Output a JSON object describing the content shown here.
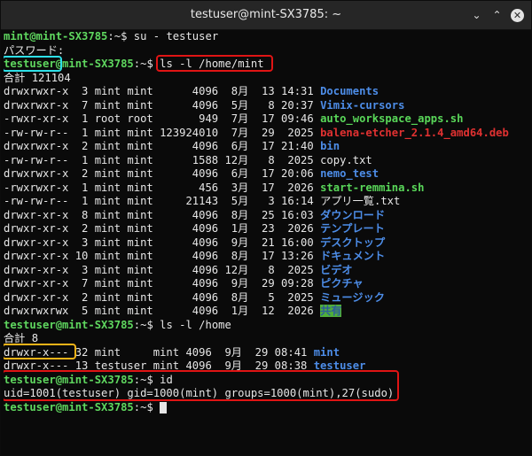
{
  "window": {
    "title": "testuser@mint-SX3785: ~"
  },
  "prompt_symbol": "$",
  "lines": {
    "l1": {
      "prompt": "mint@mint-SX3785",
      "path": ":~",
      "cmd": " su - testuser"
    },
    "l2": {
      "text": "パスワード:"
    },
    "l3": {
      "user": "testuser",
      "host": "@mint-SX3785",
      "path": ":~",
      "cmd": "ls -l /home/mint"
    },
    "l4": {
      "text": "合計 121104"
    },
    "l23": {
      "prompt": "testuser@mint-SX3785",
      "path": ":~",
      "cmd": " ls -l /home"
    },
    "l24": {
      "text": "合計 8"
    },
    "l27": {
      "prompt": "testuser@mint-SX3785",
      "path": ":~",
      "cmd": " id"
    },
    "l28": {
      "text": "uid=1001(testuser) gid=1000(mint) groups=1000(mint),27(sudo)"
    },
    "l29": {
      "prompt": "testuser@mint-SX3785",
      "path": ":~"
    }
  },
  "listing": [
    {
      "meta": "drwxrwxr-x  3 mint mint      4096  8月  13 14:31 ",
      "name": "Documents",
      "kind": "dir"
    },
    {
      "meta": "drwxrwxr-x  7 mint mint      4096  5月   8 20:37 ",
      "name": "Vimix-cursors",
      "kind": "dir"
    },
    {
      "meta": "-rwxr-xr-x  1 root root       949  7月  17 09:46 ",
      "name": "auto_workspace_apps.sh",
      "kind": "exe"
    },
    {
      "meta": "-rw-rw-r--  1 mint mint 123924010  7月  29  2025 ",
      "name": "balena-etcher_2.1.4_amd64.deb",
      "kind": "deb"
    },
    {
      "meta": "drwxrwxr-x  2 mint mint      4096  6月  17 21:40 ",
      "name": "bin",
      "kind": "dir"
    },
    {
      "meta": "-rw-rw-r--  1 mint mint      1588 12月   8  2025 ",
      "name": "copy.txt",
      "kind": "file"
    },
    {
      "meta": "drwxrwxr-x  2 mint mint      4096  6月  17 20:06 ",
      "name": "nemo_test",
      "kind": "dir"
    },
    {
      "meta": "-rwxrwxr-x  1 mint mint       456  3月  17  2026 ",
      "name": "start-remmina.sh",
      "kind": "exe"
    },
    {
      "meta": "-rw-rw-r--  1 mint mint     21143  5月   3 16:14 ",
      "name": "アプリ一覧.txt",
      "kind": "file"
    },
    {
      "meta": "drwxr-xr-x  8 mint mint      4096  8月  25 16:03 ",
      "name": "ダウンロード",
      "kind": "dir"
    },
    {
      "meta": "drwxr-xr-x  2 mint mint      4096  1月  23  2026 ",
      "name": "テンプレート",
      "kind": "dir"
    },
    {
      "meta": "drwxr-xr-x  3 mint mint      4096  9月  21 16:00 ",
      "name": "デスクトップ",
      "kind": "dir"
    },
    {
      "meta": "drwxr-xr-x 10 mint mint      4096  8月  17 13:26 ",
      "name": "ドキュメント",
      "kind": "dir"
    },
    {
      "meta": "drwxr-xr-x  3 mint mint      4096 12月   8  2025 ",
      "name": "ビデオ",
      "kind": "dir"
    },
    {
      "meta": "drwxr-xr-x  7 mint mint      4096  9月  29 09:28 ",
      "name": "ピクチャ",
      "kind": "dir"
    },
    {
      "meta": "drwxr-xr-x  2 mint mint      4096  8月   5  2025 ",
      "name": "ミュージック",
      "kind": "dir"
    },
    {
      "meta": "drwxrwxrwx  5 mint mint      4096  1月  12  2026 ",
      "name": "共有",
      "kind": "hl-dir"
    }
  ],
  "home_listing": [
    {
      "perm": "drwxr-x---",
      "meta": " 32 mint     mint 4096  9月  29 08:41 ",
      "name": "mint",
      "kind": "dir"
    },
    {
      "perm": "drwxr-x---",
      "meta": " 13 testuser mint 4096  9月  29 08:38 ",
      "name": "testuser",
      "kind": "dir"
    }
  ],
  "colors": {
    "prompt": "#5fd75f",
    "directory": "#4d8de8",
    "executable": "#59d759",
    "archive": "#e03131",
    "annotation_red": "#e01414",
    "annotation_cyan": "#2ee0e8",
    "annotation_yellow": "#f2b318"
  }
}
